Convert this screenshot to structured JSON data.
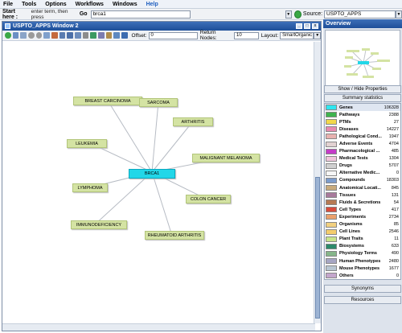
{
  "menu": [
    "File",
    "Tools",
    "Options",
    "Workflows",
    "Windows",
    "Help"
  ],
  "search": {
    "start_label": "Start here :",
    "hint": "enter term, then press",
    "go_label": "Go",
    "value": "brca1",
    "source_label": "Source:",
    "source_value": "USPTO_APPS"
  },
  "window": {
    "title": "USPTO_APPS Window 2",
    "offset_label": "Offset:",
    "offset_value": "0",
    "return_nodes_label": "Return Nodes:",
    "return_nodes_value": "10",
    "layout_label": "Layout:",
    "layout_value": "SmartOrganic"
  },
  "graph": {
    "center": "BRCA1",
    "nodes": [
      "BREAST CARCINOMA",
      "SARCOMA",
      "ARTHRITIS",
      "LEUKEMIA",
      "MALIGNANT MELANOMA",
      "LYMPHOMA",
      "COLON CANCER",
      "IMMUNODEFICIENCY",
      "RHEUMATOID ARTHRITIS"
    ]
  },
  "side": {
    "title": "Overview",
    "show_hide_label": "Show / Hide Properties",
    "summary_label": "Summary statistics",
    "synonyms_label": "Synonyms",
    "resources_label": "Resources",
    "stats": [
      {
        "name": "Genes",
        "count": "106328",
        "color": "#2fe6f0"
      },
      {
        "name": "Pathways",
        "count": "2388",
        "color": "#3fb34f"
      },
      {
        "name": "PTMs",
        "count": "27",
        "color": "#f2d84a"
      },
      {
        "name": "Diseases",
        "count": "14227",
        "color": "#e88ab0"
      },
      {
        "name": "Pathological Cond...",
        "count": "1947",
        "color": "#e8b2b0"
      },
      {
        "name": "Adverse Events",
        "count": "4704",
        "color": "#e2d2d2"
      },
      {
        "name": "Pharmacological ...",
        "count": "485",
        "color": "#c43cc8"
      },
      {
        "name": "Medical Tests",
        "count": "1304",
        "color": "#f0c6dc"
      },
      {
        "name": "Drugs",
        "count": "5707",
        "color": "#d0d0d0"
      },
      {
        "name": "Alternative Medic...",
        "count": "0",
        "color": "#f6f6f6"
      },
      {
        "name": "Compounds",
        "count": "18303",
        "color": "#7c9ccc"
      },
      {
        "name": "Anatomical Locati...",
        "count": "845",
        "color": "#c8aa7c"
      },
      {
        "name": "Tissues",
        "count": "131",
        "color": "#a87a9c"
      },
      {
        "name": "Fluids & Secretions",
        "count": "54",
        "color": "#b67a54"
      },
      {
        "name": "Cell Types",
        "count": "417",
        "color": "#d84c3c"
      },
      {
        "name": "Experiments",
        "count": "2734",
        "color": "#eaa06c"
      },
      {
        "name": "Organisms",
        "count": "85",
        "color": "#f2d080"
      },
      {
        "name": "Cell Lines",
        "count": "2546",
        "color": "#f4cc6c"
      },
      {
        "name": "Plant Traits",
        "count": "11",
        "color": "#c8e48a"
      },
      {
        "name": "Biosystems",
        "count": "633",
        "color": "#2c8a6a"
      },
      {
        "name": "Physiology Terms",
        "count": "490",
        "color": "#86b68a"
      },
      {
        "name": "Human Phenotypes",
        "count": "2480",
        "color": "#a6a6c4"
      },
      {
        "name": "Mouse Phenotypes",
        "count": "1677",
        "color": "#b8c6d2"
      },
      {
        "name": "Others",
        "count": "0",
        "color": "#c4a6cc"
      }
    ]
  }
}
